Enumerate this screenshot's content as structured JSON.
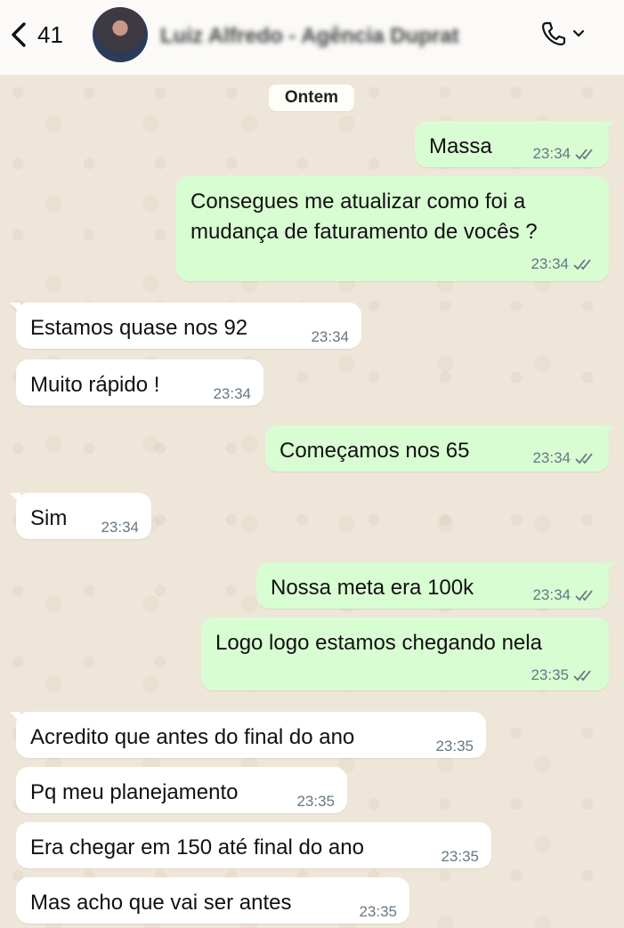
{
  "header": {
    "back_count": "41",
    "contact_name": "Luiz Alfredo - Agência Duprat"
  },
  "date_label": "Ontem",
  "messages": [
    {
      "dir": "out",
      "text": "Massa",
      "time": "23:34"
    },
    {
      "dir": "out",
      "text": "Consegues me atualizar como foi a mudança de faturamento de vocês ?",
      "line1": "Consegues me atualizar como foi a",
      "line2": "mudança de faturamento de vocês ?",
      "time": "23:34"
    },
    {
      "dir": "in",
      "text": "Estamos quase nos 92",
      "time": "23:34"
    },
    {
      "dir": "in",
      "text": "Muito rápido !",
      "time": "23:34"
    },
    {
      "dir": "out",
      "text": "Começamos nos 65",
      "time": "23:34"
    },
    {
      "dir": "in",
      "text": "Sim",
      "time": "23:34"
    },
    {
      "dir": "out",
      "text": "Nossa meta era 100k",
      "time": "23:34"
    },
    {
      "dir": "out",
      "text": "Logo logo estamos chegando nela",
      "time": "23:35"
    },
    {
      "dir": "in",
      "text": "Acredito que antes do final do ano",
      "time": "23:35"
    },
    {
      "dir": "in",
      "text": "Pq meu planejamento",
      "time": "23:35"
    },
    {
      "dir": "in",
      "text": "Era chegar em 150 até final do ano",
      "time": "23:35"
    },
    {
      "dir": "in",
      "text": "Mas acho que vai ser antes",
      "time": "23:35"
    }
  ],
  "colors": {
    "outgoing_bubble": "#d9fdd3",
    "incoming_bubble": "#ffffff",
    "read_ticks": "#667781",
    "wallpaper": "#efe6da"
  },
  "icons": [
    "back-chevron-icon",
    "phone-icon",
    "chevron-down-icon",
    "read-ticks-icon"
  ]
}
